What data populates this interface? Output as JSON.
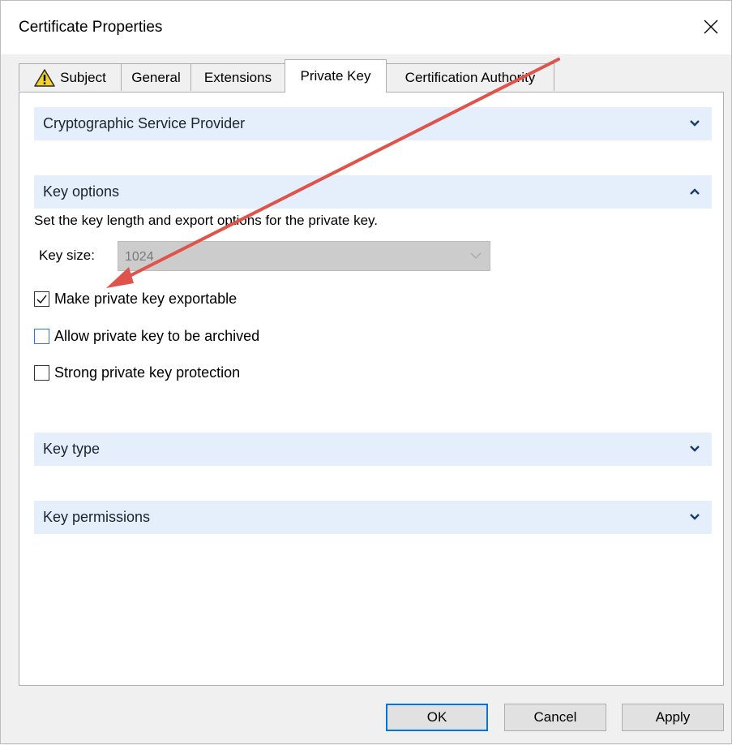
{
  "window": {
    "title": "Certificate Properties",
    "close_icon": "close-icon"
  },
  "tabs": [
    {
      "label": "Subject",
      "icon": "warning-icon",
      "active": false
    },
    {
      "label": "General",
      "active": false
    },
    {
      "label": "Extensions",
      "active": false
    },
    {
      "label": "Private Key",
      "active": true
    },
    {
      "label": "Certification Authority",
      "active": false
    }
  ],
  "sections": {
    "csp": {
      "label": "Cryptographic Service Provider",
      "expanded": false
    },
    "key_options": {
      "label": "Key options",
      "expanded": true,
      "description": "Set the key length and export options for the private key.",
      "key_size_label": "Key size:",
      "key_size_value": "1024",
      "checkboxes": [
        {
          "label": "Make private key exportable",
          "checked": true
        },
        {
          "label": "Allow private key to be archived",
          "checked": false
        },
        {
          "label": "Strong private key protection",
          "checked": false
        }
      ]
    },
    "key_type": {
      "label": "Key type",
      "expanded": false
    },
    "key_permissions": {
      "label": "Key permissions",
      "expanded": false
    }
  },
  "buttons": {
    "ok": "OK",
    "cancel": "Cancel",
    "apply": "Apply"
  },
  "colors": {
    "section_header_bg": "#e4effb",
    "annotation_arrow": "#e0534a",
    "focus_accent": "#0078d7"
  }
}
